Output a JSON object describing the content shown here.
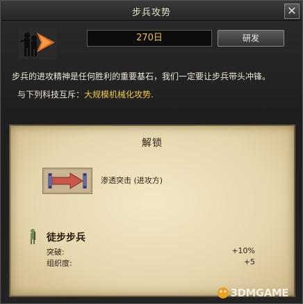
{
  "window": {
    "title": "步兵攻势",
    "close_label": "✕"
  },
  "header": {
    "days": "270日",
    "research_label": "研发"
  },
  "description": "步兵的进攻精神是任何胜利的重要基石，我们一定要让步兵带头冲锋。",
  "exclusive": {
    "prefix": "与下列科技互斥：",
    "tech": "大规模机械化攻势."
  },
  "unlock": {
    "title": "解锁",
    "tactic_label": "渗透突击 (进攻方)"
  },
  "unit": {
    "name": "徒步步兵",
    "stats": [
      {
        "name": "突破:",
        "value": "+10%"
      },
      {
        "name": "组织度:",
        "value": "+5"
      }
    ]
  },
  "watermark": "3DMGAME",
  "colors": {
    "accent_gold": "#f2cc45",
    "parchment": "#ecdcb4"
  },
  "icons": [
    "infantry-offensive-icon",
    "close-icon",
    "infiltration-assault-icon",
    "infantry-soldier-icon",
    "watermark-logo"
  ]
}
